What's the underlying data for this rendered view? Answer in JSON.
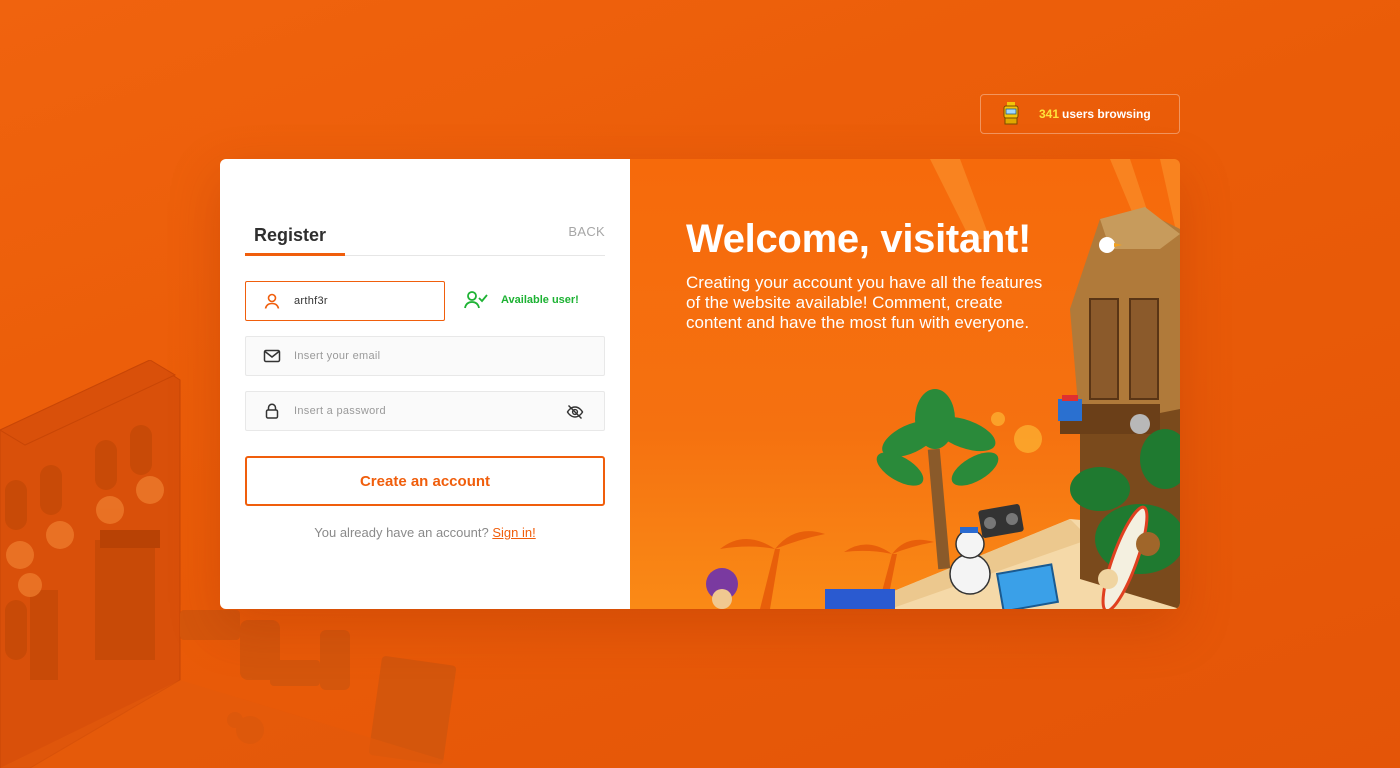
{
  "users_widget": {
    "count": "341",
    "label": "users browsing"
  },
  "form": {
    "tab_register": "Register",
    "tab_back": "BACK",
    "username": {
      "value": "arthf3r",
      "status": "Available user!"
    },
    "email": {
      "placeholder": "Insert your email"
    },
    "password": {
      "placeholder": "Insert a password"
    },
    "create_button": "Create an account",
    "signin_prompt": "You already have an account?",
    "signin_link": "Sign in!"
  },
  "hero": {
    "title": "Welcome, visitant!",
    "description": "Creating your account you have all the features of the website available! Comment, create content and have the most fun with everyone."
  },
  "icons": {
    "users_widget": "robot-icon",
    "username": "user-icon",
    "status": "user-check-icon",
    "email": "mail-icon",
    "password": "lock-icon",
    "toggle": "eye-off-icon"
  },
  "colors": {
    "accent": "#f05e0c",
    "background": "#ea5c08",
    "success": "#1db233",
    "highlight": "#ffe23a"
  }
}
